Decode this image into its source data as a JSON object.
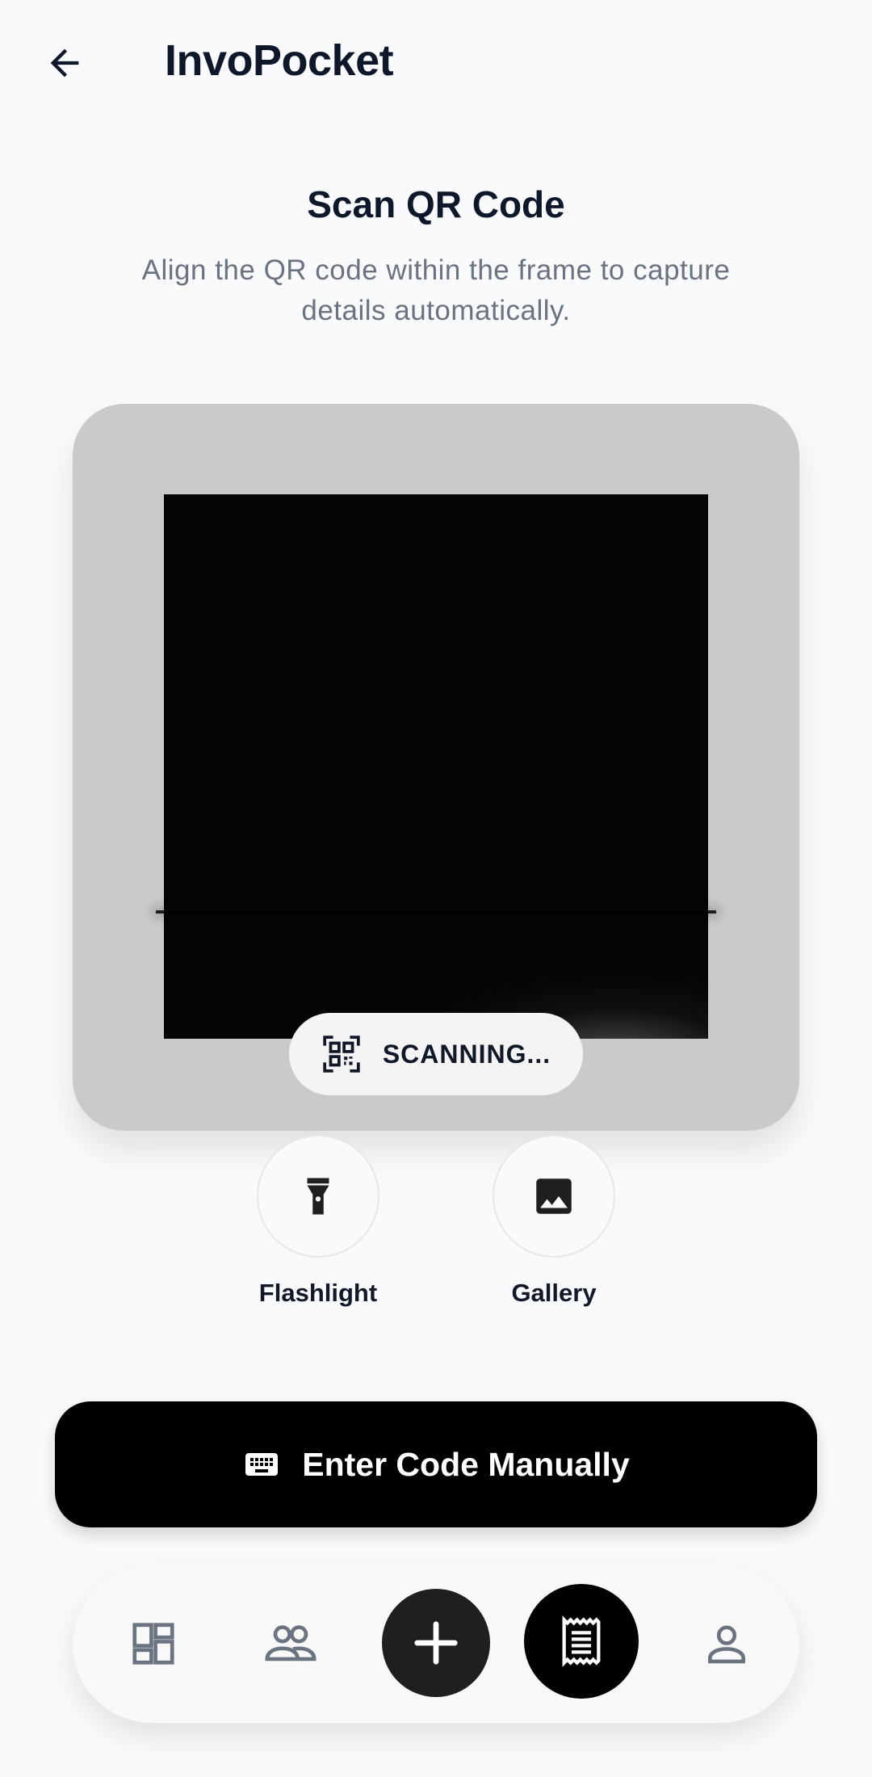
{
  "header": {
    "title": "InvoPocket",
    "back_icon": "arrow-left-icon"
  },
  "scanner": {
    "title": "Scan QR Code",
    "subtitle": "Align the QR code within the frame to capture details automatically.",
    "status_label": "SCANNING...",
    "status_icon": "qr-code-scan-icon"
  },
  "tools": [
    {
      "label": "Flashlight",
      "icon": "flashlight-icon"
    },
    {
      "label": "Gallery",
      "icon": "image-icon"
    }
  ],
  "manual_entry": {
    "label": "Enter Code Manually",
    "icon": "keyboard-icon"
  },
  "bottom_nav": {
    "items": [
      {
        "icon": "dashboard-icon"
      },
      {
        "icon": "people-icon"
      },
      {
        "icon": "plus-icon"
      },
      {
        "icon": "receipt-icon",
        "active": true
      },
      {
        "icon": "person-icon"
      }
    ]
  },
  "colors": {
    "background": "#f8fafc",
    "text_primary": "#0f172a",
    "text_secondary": "#6b7280",
    "scanner_card": "#c9cacc",
    "camera": "#050505",
    "button_dark": "#000000",
    "nav_icon": "#6b7280"
  }
}
